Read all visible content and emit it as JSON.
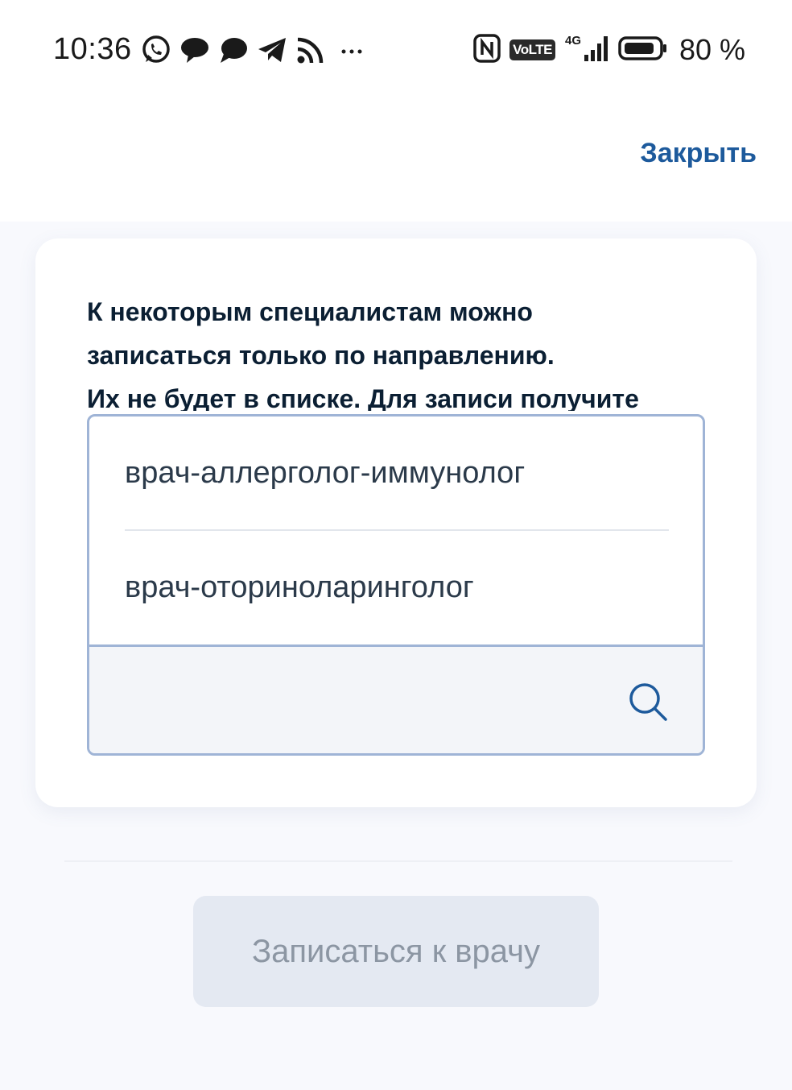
{
  "status_bar": {
    "time": "10:36",
    "battery_percent": "80 %",
    "network_label": "VoLTE",
    "network_type": "4G",
    "notification_icons": [
      "whatsapp-icon",
      "chat-bubble-icon",
      "message-icon",
      "telegram-icon",
      "cast-icon",
      "more-dots-icon"
    ],
    "system_icons": [
      "nfc-icon",
      "volte-icon",
      "signal-4g-icon",
      "battery-icon"
    ]
  },
  "header": {
    "close_label": "Закрыть"
  },
  "card": {
    "notice_lines": [
      "К некоторым специалистам можно",
      "записаться только по направлению.",
      "Их не будет в списке. Для записи получите"
    ],
    "dropdown": {
      "options": [
        "врач-аллерголог-иммунолог",
        "врач-оториноларинголог"
      ],
      "search_value": "",
      "search_icon": "search-icon"
    }
  },
  "footer": {
    "submit_label": "Записаться к врачу",
    "submit_enabled": false
  },
  "colors": {
    "accent_link": "#1d5a9c",
    "dropdown_border": "#9fb4d6",
    "disabled_button_bg": "#e4e9f2",
    "disabled_button_text": "#8c96a3",
    "page_bg": "#f8f9fd"
  }
}
